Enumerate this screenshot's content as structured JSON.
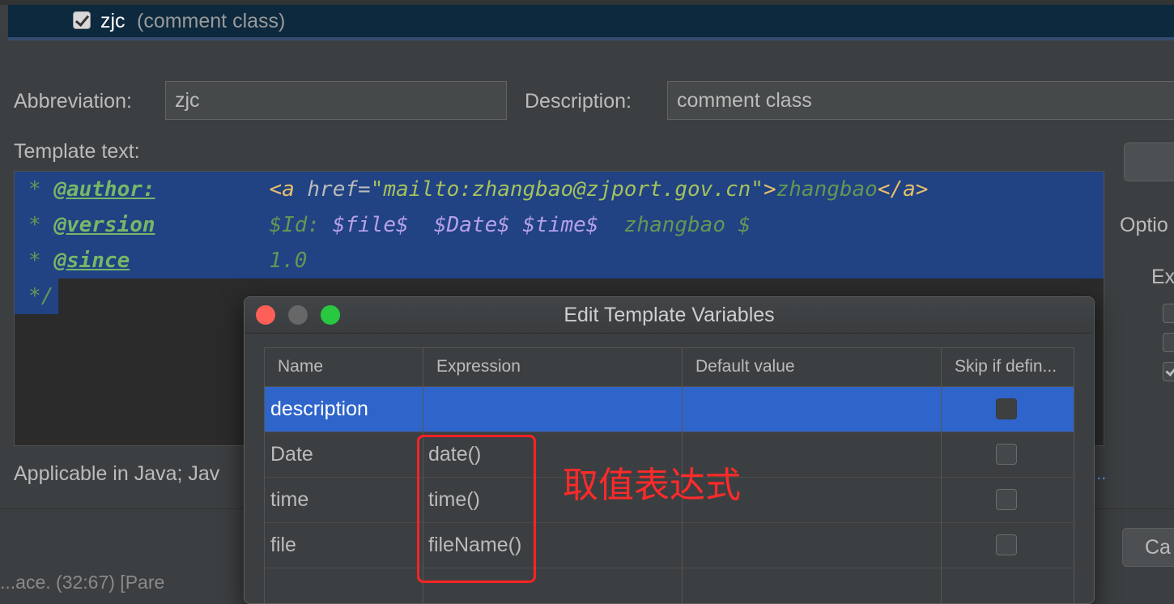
{
  "template_list": {
    "selected_row": {
      "abbreviation": "zjc",
      "description": "(comment class)",
      "checked": true
    }
  },
  "form": {
    "abbreviation_label": "Abbreviation:",
    "abbreviation_value": "zjc",
    "description_label": "Description:",
    "description_value": "comment class",
    "template_text_label": "Template text:"
  },
  "template_text": {
    "line1": {
      "star": "* ",
      "tag": "@author:",
      "pad": "         ",
      "open_tag": "<a ",
      "attr": "href=",
      "value": "\"mailto:zhangbao@zjport.gov.cn\"",
      "gt": ">",
      "text": "zhangbao",
      "close_tag": "</a>"
    },
    "line2": {
      "star": "* ",
      "tag": "@version",
      "pad": "         ",
      "id_text": "$Id: ",
      "var_file": "$file$",
      "gap1": "  ",
      "var_date": "$Date$",
      "gap2": " ",
      "var_time": "$time$",
      "tail": "  zhangbao $"
    },
    "line3": {
      "star": "* ",
      "tag": "@since",
      "pad": "           ",
      "value": "1.0"
    },
    "line4": "*/"
  },
  "right_panel": {
    "options_label": "Optio",
    "expand_label": "Ex",
    "checkbox_states": [
      false,
      false,
      true
    ]
  },
  "applicable_text": "Applicable in Java; Jav",
  "change_link": "...",
  "bottom": {
    "cancel_label": "Ca",
    "status_fragment": "...ace. (32:67) [Pare"
  },
  "dialog": {
    "title": "Edit Template Variables",
    "columns": [
      "Name",
      "Expression",
      "Default value",
      "Skip if defin..."
    ],
    "rows": [
      {
        "name": "description",
        "expression": "",
        "default": "",
        "skip": false,
        "selected": true
      },
      {
        "name": "Date",
        "expression": "date()",
        "default": "",
        "skip": false,
        "selected": false
      },
      {
        "name": "time",
        "expression": "time()",
        "default": "",
        "skip": false,
        "selected": false
      },
      {
        "name": "file",
        "expression": "fileName()",
        "default": "",
        "skip": false,
        "selected": false
      }
    ]
  },
  "annotation": {
    "text": "取值表达式",
    "color": "#ff2a2a"
  },
  "colors": {
    "selection": "#2f65ca",
    "editor_selection": "#214283",
    "background": "#3c3f41"
  }
}
